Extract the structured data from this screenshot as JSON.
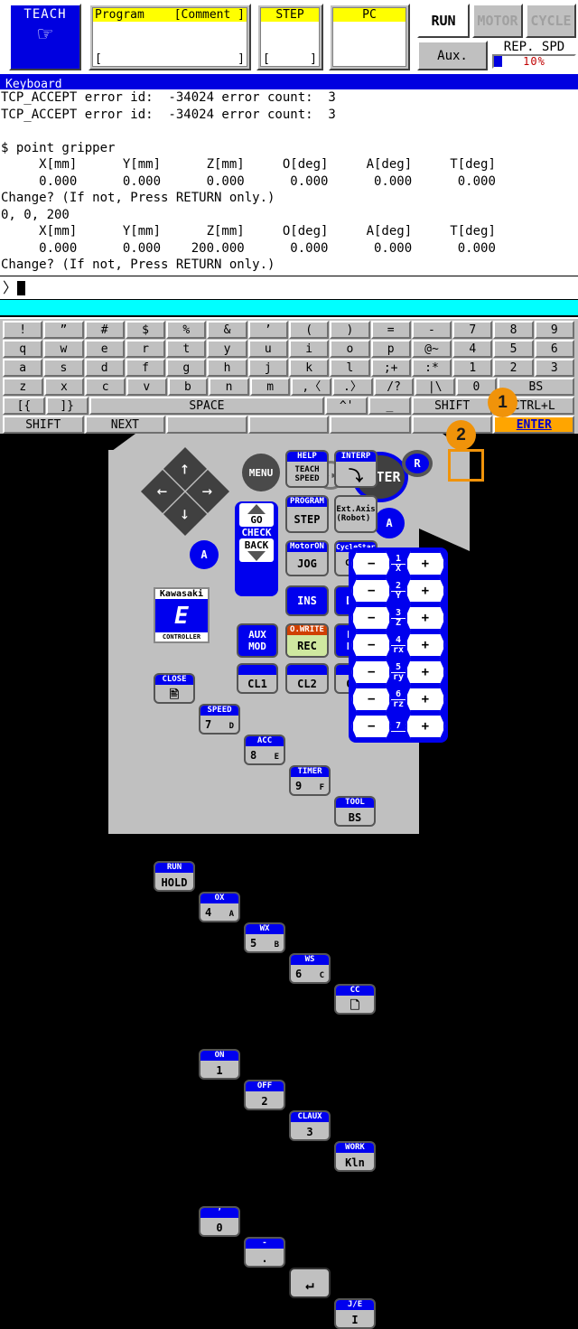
{
  "header": {
    "mode": {
      "label": "TEACH",
      "icon": "pointing-hand-icon"
    },
    "program": {
      "title_left": "Program",
      "title_right": "[Comment ]",
      "value_open": "[",
      "value_close": "]"
    },
    "step": {
      "title": "STEP",
      "value_open": "[",
      "value_close": "]"
    },
    "pc": {
      "title": "PC"
    },
    "status": {
      "run": "RUN",
      "motor": "MOTOR",
      "cycle": "CYCLE",
      "aux": "Aux."
    },
    "speed": {
      "label": "REP. SPD",
      "value": "10%",
      "percent": 10
    },
    "colors": {
      "teach_blue": "#0000e0",
      "title_yellow": "#ffff00",
      "accent_orange": "#f0930a",
      "cyan": "#00ffff"
    }
  },
  "terminal": {
    "title": "Keyboard",
    "lines": "TCP_ACCEPT error id:  -34024 error count:  3\nTCP_ACCEPT error id:  -34024 error count:  3\n\n$ point gripper\n     X[mm]      Y[mm]      Z[mm]     O[deg]     A[deg]     T[deg]\n     0.000      0.000      0.000      0.000      0.000      0.000\nChange? (If not, Press RETURN only.)\n0, 0, 200\n     X[mm]      Y[mm]      Z[mm]     O[deg]     A[deg]     T[deg]\n     0.000      0.000    200.000      0.000      0.000      0.000\nChange? (If not, Press RETURN only.)",
    "prompt_symbol": "〉",
    "prompt_value": ""
  },
  "keyboard": {
    "rows": [
      [
        {
          "l": "!",
          "w": 1
        },
        {
          "l": "”",
          "w": 1
        },
        {
          "l": "#",
          "w": 1
        },
        {
          "l": "$",
          "w": 1
        },
        {
          "l": "%",
          "w": 1
        },
        {
          "l": "&",
          "w": 1
        },
        {
          "l": "’",
          "w": 1
        },
        {
          "l": "(",
          "w": 1
        },
        {
          "l": ")",
          "w": 1
        },
        {
          "l": "=",
          "w": 1
        },
        {
          "l": "-",
          "w": 1
        },
        {
          "l": "7",
          "w": 1
        },
        {
          "l": "8",
          "w": 1
        },
        {
          "l": "9",
          "w": 1
        }
      ],
      [
        {
          "l": "q",
          "w": 1
        },
        {
          "l": "w",
          "w": 1
        },
        {
          "l": "e",
          "w": 1
        },
        {
          "l": "r",
          "w": 1
        },
        {
          "l": "t",
          "w": 1
        },
        {
          "l": "y",
          "w": 1
        },
        {
          "l": "u",
          "w": 1
        },
        {
          "l": "i",
          "w": 1
        },
        {
          "l": "o",
          "w": 1
        },
        {
          "l": "p",
          "w": 1
        },
        {
          "l": "@~",
          "w": 1
        },
        {
          "l": "4",
          "w": 1
        },
        {
          "l": "5",
          "w": 1
        },
        {
          "l": "6",
          "w": 1
        }
      ],
      [
        {
          "l": "a",
          "w": 1
        },
        {
          "l": "s",
          "w": 1
        },
        {
          "l": "d",
          "w": 1
        },
        {
          "l": "f",
          "w": 1
        },
        {
          "l": "g",
          "w": 1
        },
        {
          "l": "h",
          "w": 1
        },
        {
          "l": "j",
          "w": 1
        },
        {
          "l": "k",
          "w": 1
        },
        {
          "l": "l",
          "w": 1
        },
        {
          "l": ";+",
          "w": 1
        },
        {
          "l": ":*",
          "w": 1
        },
        {
          "l": "1",
          "w": 1
        },
        {
          "l": "2",
          "w": 1
        },
        {
          "l": "3",
          "w": 1
        }
      ],
      [
        {
          "l": "z",
          "w": 1
        },
        {
          "l": "x",
          "w": 1
        },
        {
          "l": "c",
          "w": 1
        },
        {
          "l": "v",
          "w": 1
        },
        {
          "l": "b",
          "w": 1
        },
        {
          "l": "n",
          "w": 1
        },
        {
          "l": "m",
          "w": 1
        },
        {
          "l": ",〈",
          "w": 1
        },
        {
          "l": ".〉",
          "w": 1
        },
        {
          "l": "/?",
          "w": 1
        },
        {
          "l": "|\\",
          "w": 1
        },
        {
          "l": "0",
          "w": 1
        },
        {
          "l": "BS",
          "w": 2
        }
      ],
      [
        {
          "l": "[{",
          "w": 1
        },
        {
          "l": "]}",
          "w": 1
        },
        {
          "l": "SPACE",
          "w": 6
        },
        {
          "l": "^'",
          "w": 1
        },
        {
          "l": "_",
          "w": 1
        },
        {
          "l": "SHIFT",
          "w": 2
        },
        {
          "l": "CTRL+L",
          "w": 2
        }
      ],
      [
        {
          "l": "SHIFT",
          "w": 2
        },
        {
          "l": "NEXT",
          "w": 2
        },
        {
          "l": "",
          "w": 2
        },
        {
          "l": "",
          "w": 2
        },
        {
          "l": "",
          "w": 2
        },
        {
          "l": "",
          "w": 2
        },
        {
          "l": "ENTER",
          "w": 2,
          "hl": true
        }
      ]
    ]
  },
  "pendant": {
    "arrows": {
      "up": "↑",
      "down": "↓",
      "left": "←",
      "right": "→"
    },
    "menu": "MENU",
    "fkeys": [
      {
        "cap": "HELP",
        "bot": "TEACH\nSPEED",
        "name": "teach-speed-key"
      },
      {
        "cap": "INTERP",
        "bot": "⤴",
        "name": "interp-key"
      },
      {
        "cap": "PROGRAM",
        "bot": "STEP",
        "name": "program-step-key"
      },
      {
        "cap": "Ext.Axis",
        "bot": "(Robot)",
        "name": "ext-axis-key"
      },
      {
        "cap": "MotorON",
        "bot": "JOG",
        "name": "motor-on-jog-key"
      },
      {
        "cap": "CycleStart",
        "bot": "CONT",
        "name": "cycle-start-cont-key"
      }
    ],
    "gocheck": {
      "go": "GO",
      "check": "CHECK",
      "back": "BACK"
    },
    "ins": "INS",
    "del": "DEL",
    "aux_mod": "AUX\nMOD",
    "rec": {
      "cap": "O.WRITE",
      "bot": "REC"
    },
    "pos_mod": "POS\nMOD",
    "cl_keys": [
      "CL1",
      "CL2",
      "CLn"
    ],
    "numpad": [
      {
        "cap": "CLOSE",
        "n": "",
        "a": "",
        "c": "⎘"
      },
      {
        "cap": "SPEED",
        "n": "7",
        "a": "D",
        "c": ""
      },
      {
        "cap": "ACC",
        "n": "8",
        "a": "E",
        "c": ""
      },
      {
        "cap": "TIMER",
        "n": "9",
        "a": "F",
        "c": ""
      },
      {
        "cap": "TOOL",
        "n": "",
        "a": "",
        "c": "BS"
      },
      {
        "cap": "RUN",
        "n": "",
        "a": "",
        "c": "HOLD"
      },
      {
        "cap": "OX",
        "n": "4",
        "a": "A",
        "c": ""
      },
      {
        "cap": "WX",
        "n": "5",
        "a": "B",
        "c": ""
      },
      {
        "cap": "WS",
        "n": "6",
        "a": "C",
        "c": ""
      },
      {
        "cap": "CC",
        "n": "",
        "a": "",
        "c": "❑"
      },
      {
        "cap": "ON",
        "n": "",
        "a": "",
        "c": "1"
      },
      {
        "cap": "OFF",
        "n": "",
        "a": "",
        "c": "2"
      },
      {
        "cap": "CLAUX",
        "n": "",
        "a": "",
        "c": "3"
      },
      {
        "cap": "WORK",
        "n": "",
        "a": "",
        "c": "Kln"
      },
      {
        "cap": "’",
        "n": "",
        "a": "",
        "c": "0"
      },
      {
        "cap": "-",
        "n": "",
        "a": "",
        "c": "."
      },
      {
        "cap": "",
        "n": "",
        "a": "",
        "c": "↵"
      },
      {
        "cap": "J/E",
        "n": "",
        "a": "",
        "c": "I"
      }
    ],
    "enter": "ENTER",
    "a_button": "A",
    "r_button": "R",
    "ff_icon": "fast-forward-icon",
    "axes": [
      {
        "num": "1",
        "ax": "X"
      },
      {
        "num": "2",
        "ax": "Y"
      },
      {
        "num": "3",
        "ax": "Z"
      },
      {
        "num": "4",
        "ax": "rx"
      },
      {
        "num": "5",
        "ax": "ry"
      },
      {
        "num": "6",
        "ax": "rz"
      },
      {
        "num": "7",
        "ax": ""
      }
    ],
    "axis_minus": "−",
    "axis_plus": "+",
    "logo": {
      "top": "Kawasaki",
      "mid": "E",
      "bottom": "CONTROLLER"
    }
  },
  "annotations": {
    "marker1": "1",
    "marker2": "2"
  }
}
